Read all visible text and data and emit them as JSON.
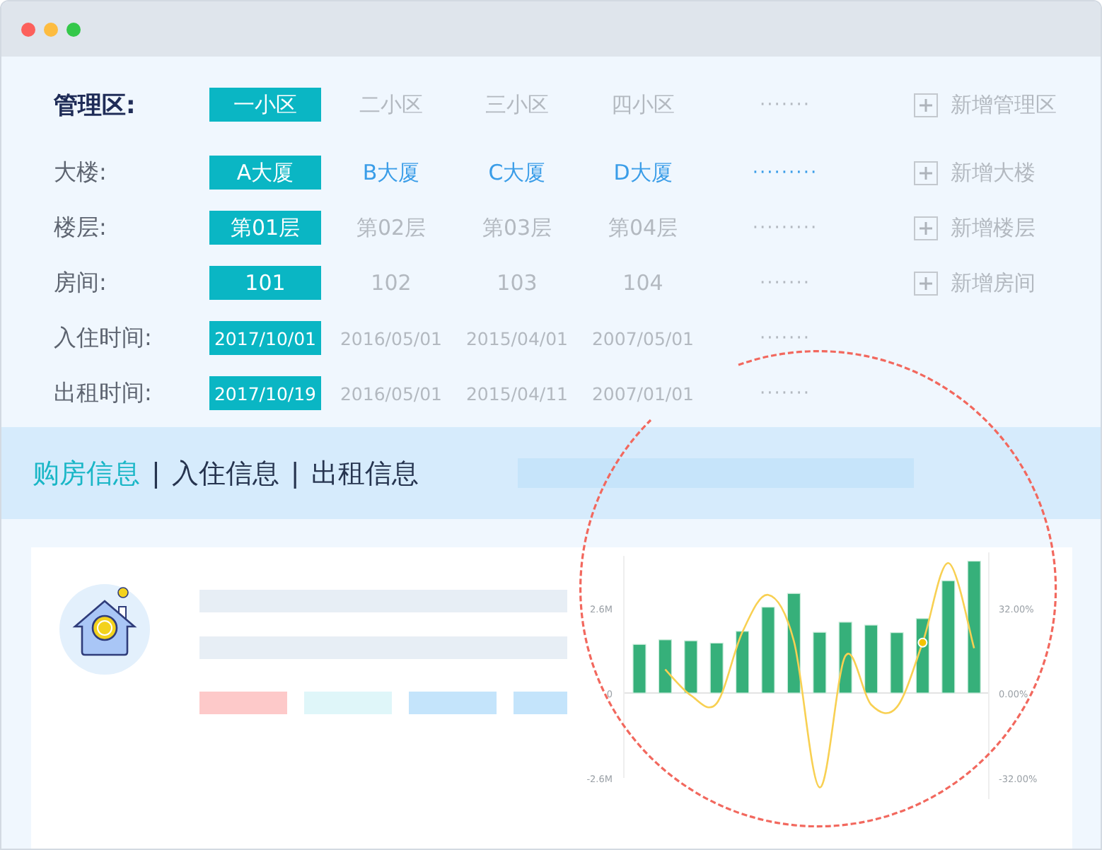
{
  "filters": [
    {
      "label": "管理区:",
      "active": true,
      "kind": "plain",
      "options": [
        {
          "label": "一小区",
          "selected": true
        },
        {
          "label": "二小区",
          "selected": false
        },
        {
          "label": "三小区",
          "selected": false
        },
        {
          "label": "四小区",
          "selected": false
        }
      ],
      "more": "·······",
      "add": "新增管理区"
    },
    {
      "label": "大楼:",
      "active": false,
      "kind": "link",
      "options": [
        {
          "label": "A大厦",
          "selected": true
        },
        {
          "label": "B大厦",
          "selected": false
        },
        {
          "label": "C大厦",
          "selected": false
        },
        {
          "label": "D大厦",
          "selected": false
        }
      ],
      "more": "·········",
      "add": "新增大楼"
    },
    {
      "label": "楼层:",
      "active": false,
      "kind": "plain",
      "options": [
        {
          "label": "第01层",
          "selected": true
        },
        {
          "label": "第02层",
          "selected": false
        },
        {
          "label": "第03层",
          "selected": false
        },
        {
          "label": "第04层",
          "selected": false
        }
      ],
      "more": "·········",
      "add": "新增楼层"
    },
    {
      "label": "房间:",
      "active": false,
      "kind": "plain",
      "options": [
        {
          "label": "101",
          "selected": true
        },
        {
          "label": "102",
          "selected": false
        },
        {
          "label": "103",
          "selected": false
        },
        {
          "label": "104",
          "selected": false
        }
      ],
      "more": "·······",
      "add": "新增房间"
    },
    {
      "label": "入住时间:",
      "active": false,
      "kind": "date",
      "options": [
        {
          "label": "2017/10/01",
          "selected": true
        },
        {
          "label": "2016/05/01",
          "selected": false
        },
        {
          "label": "2015/04/01",
          "selected": false
        },
        {
          "label": "2007/05/01",
          "selected": false
        }
      ],
      "more": "·······"
    },
    {
      "label": "出租时间:",
      "active": false,
      "kind": "date",
      "options": [
        {
          "label": "2017/10/19",
          "selected": true
        },
        {
          "label": "2016/05/01",
          "selected": false
        },
        {
          "label": "2015/04/11",
          "selected": false
        },
        {
          "label": "2007/01/01",
          "selected": false
        }
      ],
      "more": "·······"
    }
  ],
  "tabs": [
    {
      "label": "购房信息",
      "selected": true
    },
    {
      "label": "入住信息",
      "selected": false
    },
    {
      "label": "出租信息",
      "selected": false
    }
  ],
  "tab_separator": "|",
  "card": {
    "tag_blocks": [
      {
        "color": "#fdc9c9"
      },
      {
        "color": "#dff6f9"
      },
      {
        "color": "#c4e4fb"
      },
      {
        "color": "#c4e4fb"
      }
    ],
    "chart_data": {
      "type": "bar",
      "series": [
        {
          "type": "bar",
          "color": "#36b07a",
          "values": [
            1.49,
            1.63,
            1.6,
            1.53,
            1.89,
            2.63,
            3.05,
            1.86,
            2.17,
            2.08,
            1.85,
            2.28,
            3.44,
            4.04
          ]
        },
        {
          "type": "line",
          "axis": "y2",
          "color": "#f8d052",
          "values": [
            null,
            8.9,
            -0.9,
            -3.9,
            23,
            37,
            19.6,
            -35.6,
            14,
            -4.4,
            -5.3,
            19,
            49,
            16.9
          ]
        }
      ],
      "ylim": [
        -2.6,
        4.2
      ],
      "y2lim": [
        -40,
        53
      ],
      "yticks": [
        {
          "value": 2.6,
          "label": "2.6M"
        },
        {
          "value": 0,
          "label": "0"
        },
        {
          "value": -2.6,
          "label": "-2.6M"
        }
      ],
      "y2ticks": [
        {
          "value": 32,
          "label": "32.00%"
        },
        {
          "value": 0,
          "label": "0.00%"
        },
        {
          "value": -32,
          "label": "-32.00%"
        }
      ]
    }
  }
}
